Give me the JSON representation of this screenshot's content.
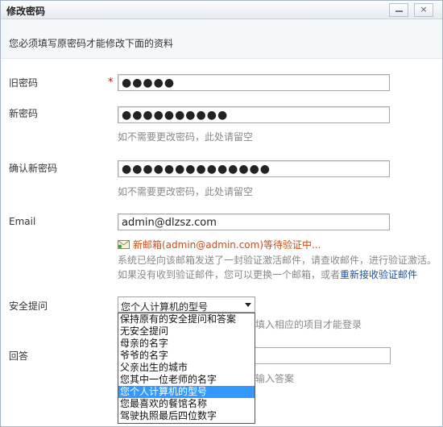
{
  "window": {
    "title": "修改密码",
    "minimize_glyph": "",
    "close_glyph": "×"
  },
  "notice": "您必须填写原密码才能修改下面的资料",
  "fields": {
    "old_password": {
      "label": "旧密码",
      "required_mark": "*",
      "value": "●●●●●"
    },
    "new_password": {
      "label": "新密码",
      "value": "●●●●●●●●●●",
      "hint": "如不需要更改密码，此处请留空"
    },
    "confirm_password": {
      "label": "确认新密码",
      "value": "●●●●●●●●●●●●●●",
      "hint": "如不需要更改密码，此处请留空"
    },
    "email": {
      "label": "Email",
      "value": "admin@dlzsz.com"
    }
  },
  "email_notice": {
    "pending": "新邮箱(admin@admin.com)等待验证中...",
    "line1": "系统已经向该邮箱发送了一封验证激活邮件，请查收邮件，进行验证激活。",
    "line2_prefix": "如果没有收到验证邮件，您可以更换一个邮箱，或者",
    "resend_link": "重新接收验证邮件"
  },
  "security": {
    "label": "安全提问",
    "selected": "您个人计算机的型号",
    "behind_hint": "填入相应的项目才能登录",
    "options": [
      "保持原有的安全提问和答案",
      "无安全提问",
      "母亲的名字",
      "爷爷的名字",
      "父亲出生的城市",
      "您其中一位老师的名字",
      "您个人计算机的型号",
      "您最喜欢的餐馆名称",
      "驾驶执照最后四位数字"
    ],
    "selected_index": 6
  },
  "answer": {
    "label": "回答",
    "behind_hint": "输入答案"
  },
  "colors": {
    "accent": "#3399ff",
    "link": "#1a54a5",
    "pending": "#c3501a",
    "required": "#ee0000"
  }
}
